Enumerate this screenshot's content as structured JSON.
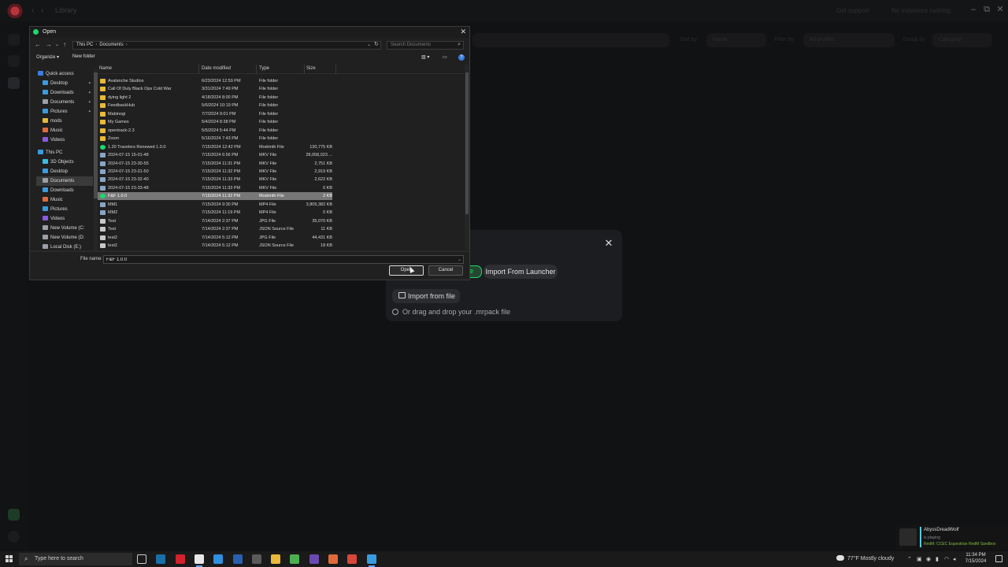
{
  "app": {
    "breadcrumb": "Library",
    "get_support": "Get support",
    "no_instances": "No instances running",
    "sort_label": "Sort by",
    "sort_value": "Name",
    "filter_label": "Filter by",
    "filter_value": "All profiles",
    "group_label": "Group by",
    "group_value": "Category",
    "colors": {
      "accent": "#1bd96a",
      "bg": "#111213",
      "modal": "#1c1d20"
    }
  },
  "modal": {
    "tab_file": "le",
    "tab_launcher": "Import From Launcher",
    "import_button": "Import from file",
    "drop_hint": "Or drag and drop your .mrpack file",
    "close_icon": "close-icon"
  },
  "dialog": {
    "title": "Open",
    "address": {
      "root": "This PC",
      "folder": "Documents"
    },
    "search_placeholder": "Search Documents",
    "toolbar": {
      "organize": "Organize ▾",
      "new_folder": "New folder",
      "help": "?"
    },
    "tree": [
      {
        "label": "Quick access",
        "icon": "star-icon",
        "color": "#3a7de0",
        "indent": 0
      },
      {
        "label": "Desktop",
        "icon": "desktop-icon",
        "color": "#3a9be0",
        "indent": 1,
        "pinned": true
      },
      {
        "label": "Downloads",
        "icon": "download-icon",
        "color": "#3a9be0",
        "indent": 1,
        "pinned": true
      },
      {
        "label": "Documents",
        "icon": "document-icon",
        "color": "#9aa0a6",
        "indent": 1,
        "pinned": true
      },
      {
        "label": "Pictures",
        "icon": "picture-icon",
        "color": "#3a9be0",
        "indent": 1,
        "pinned": true
      },
      {
        "label": "mods",
        "icon": "folder-icon",
        "color": "#e8b93a",
        "indent": 1
      },
      {
        "label": "Music",
        "icon": "music-icon",
        "color": "#e06a3a",
        "indent": 1
      },
      {
        "label": "Videos",
        "icon": "video-icon",
        "color": "#8a5ae0",
        "indent": 1
      },
      {
        "label": "This PC",
        "icon": "computer-icon",
        "color": "#3a9be0",
        "indent": 0
      },
      {
        "label": "3D Objects",
        "icon": "cube-icon",
        "color": "#3abfe0",
        "indent": 1
      },
      {
        "label": "Desktop",
        "icon": "desktop-icon",
        "color": "#3a9be0",
        "indent": 1
      },
      {
        "label": "Documents",
        "icon": "document-icon",
        "color": "#9aa0a6",
        "indent": 1,
        "selected": true
      },
      {
        "label": "Downloads",
        "icon": "download-icon",
        "color": "#3a9be0",
        "indent": 1
      },
      {
        "label": "Music",
        "icon": "music-icon",
        "color": "#e06a3a",
        "indent": 1
      },
      {
        "label": "Pictures",
        "icon": "picture-icon",
        "color": "#3a9be0",
        "indent": 1
      },
      {
        "label": "Videos",
        "icon": "video-icon",
        "color": "#8a5ae0",
        "indent": 1
      },
      {
        "label": "New Volume (C:",
        "icon": "drive-icon",
        "color": "#9aa0a6",
        "indent": 1
      },
      {
        "label": "New Volume (D:",
        "icon": "drive-icon",
        "color": "#9aa0a6",
        "indent": 1
      },
      {
        "label": "Local Disk (E:)",
        "icon": "drive-icon",
        "color": "#9aa0a6",
        "indent": 1
      }
    ],
    "columns": {
      "name": "Name",
      "date": "Date modified",
      "type": "Type",
      "size": "Size"
    },
    "files": [
      {
        "name": "Avalanche Studios",
        "date": "6/23/2024 12:59 PM",
        "type": "File folder",
        "size": "",
        "icon": "folder-icon"
      },
      {
        "name": "Call Of Duty Black Ops Cold War",
        "date": "3/31/2024 7:49 PM",
        "type": "File folder",
        "size": "",
        "icon": "folder-icon"
      },
      {
        "name": "dying light 2",
        "date": "4/18/2024 8:00 PM",
        "type": "File folder",
        "size": "",
        "icon": "folder-icon"
      },
      {
        "name": "FeedbackHub",
        "date": "5/6/2024 10:19 PM",
        "type": "File folder",
        "size": "",
        "icon": "folder-icon"
      },
      {
        "name": "Mabinogi",
        "date": "7/7/2024 9:01 PM",
        "type": "File folder",
        "size": "",
        "icon": "folder-icon"
      },
      {
        "name": "My Games",
        "date": "5/4/2024 8:38 PM",
        "type": "File folder",
        "size": "",
        "icon": "folder-icon"
      },
      {
        "name": "opentrack-2.3",
        "date": "5/5/2024 5:44 PM",
        "type": "File folder",
        "size": "",
        "icon": "folder-icon"
      },
      {
        "name": "Zoom",
        "date": "5/16/2024 7:43 PM",
        "type": "File folder",
        "size": "",
        "icon": "folder-icon"
      },
      {
        "name": "1.20 Travelers Renewed 1.0.0",
        "date": "7/15/2024 12:42 PM",
        "type": "Modrinth File",
        "size": "130,775 KB",
        "icon": "modrinth-icon"
      },
      {
        "name": "2024-07-15 15-01-48",
        "date": "7/15/2024 6:56 PM",
        "type": "MKV File",
        "size": "28,058,023 ...",
        "icon": "video-file-icon"
      },
      {
        "name": "2024-07-15 23-30-55",
        "date": "7/15/2024 11:31 PM",
        "type": "MKV File",
        "size": "2,751 KB",
        "icon": "video-file-icon"
      },
      {
        "name": "2024-07-15 23-31-50",
        "date": "7/15/2024 11:32 PM",
        "type": "MKV File",
        "size": "2,919 KB",
        "icon": "video-file-icon"
      },
      {
        "name": "2024-07-15 23-32-40",
        "date": "7/15/2024 11:33 PM",
        "type": "MKV File",
        "size": "2,622 KB",
        "icon": "video-file-icon"
      },
      {
        "name": "2024-07-15 23-33-48",
        "date": "7/15/2024 11:33 PM",
        "type": "MKV File",
        "size": "0 KB",
        "icon": "video-file-icon"
      },
      {
        "name": "F&F 1.0.0",
        "date": "7/15/2024 11:32 PM",
        "type": "Modrinth File",
        "size": "2 KB",
        "icon": "modrinth-icon",
        "selected": true
      },
      {
        "name": "MM1",
        "date": "7/15/2024 9:30 PM",
        "type": "MP4 File",
        "size": "3,809,382 KB",
        "icon": "video-file-icon"
      },
      {
        "name": "MM2",
        "date": "7/15/2024 11:19 PM",
        "type": "MP4 File",
        "size": "0 KB",
        "icon": "video-file-icon"
      },
      {
        "name": "Test",
        "date": "7/14/2024 2:37 PM",
        "type": "JPG File",
        "size": "35,070 KB",
        "icon": "image-file-icon"
      },
      {
        "name": "Test",
        "date": "7/14/2024 2:37 PM",
        "type": "JSON Source File",
        "size": "11 KB",
        "icon": "json-file-icon"
      },
      {
        "name": "test2",
        "date": "7/14/2024 5:12 PM",
        "type": "JPG File",
        "size": "44,431 KB",
        "icon": "image-file-icon"
      },
      {
        "name": "test2",
        "date": "7/14/2024 5:12 PM",
        "type": "JSON Source File",
        "size": "18 KB",
        "icon": "json-file-icon"
      }
    ],
    "filename_label": "File name:",
    "filename_value": "F&F 1.0.0",
    "open_button": "Open",
    "cancel_button": "Cancel"
  },
  "notification": {
    "name": "AbyssDreadWolf",
    "status": "is playing",
    "game": "RedM: CCEC Equestrian RedM Sandbox"
  },
  "taskbar": {
    "search_placeholder": "Type here to search",
    "weather": "77°F  Mostly cloudy",
    "time": "11:34 PM",
    "date": "7/15/2024",
    "apps": [
      {
        "name": "task-view-icon",
        "color": "#cfcfcf"
      },
      {
        "name": "steam-icon",
        "color": "#1b6fa8"
      },
      {
        "name": "opera-icon",
        "color": "#d1222d"
      },
      {
        "name": "notepad-icon",
        "color": "#e8e8e8",
        "active": true
      },
      {
        "name": "vscode-icon",
        "color": "#2f8fe0"
      },
      {
        "name": "r-icon",
        "color": "#2a5fb0"
      },
      {
        "name": "calculator-icon",
        "color": "#5a5a5a"
      },
      {
        "name": "explorer-icon",
        "color": "#e8b93a"
      },
      {
        "name": "minecraft-icon",
        "color": "#4caf50"
      },
      {
        "name": "obs-icon",
        "color": "#6a4ab0"
      },
      {
        "name": "game-icon",
        "color": "#e06a3a"
      },
      {
        "name": "chrome-icon",
        "color": "#d9463a"
      },
      {
        "name": "app-icon",
        "color": "#3a9be0",
        "active": true
      }
    ]
  }
}
